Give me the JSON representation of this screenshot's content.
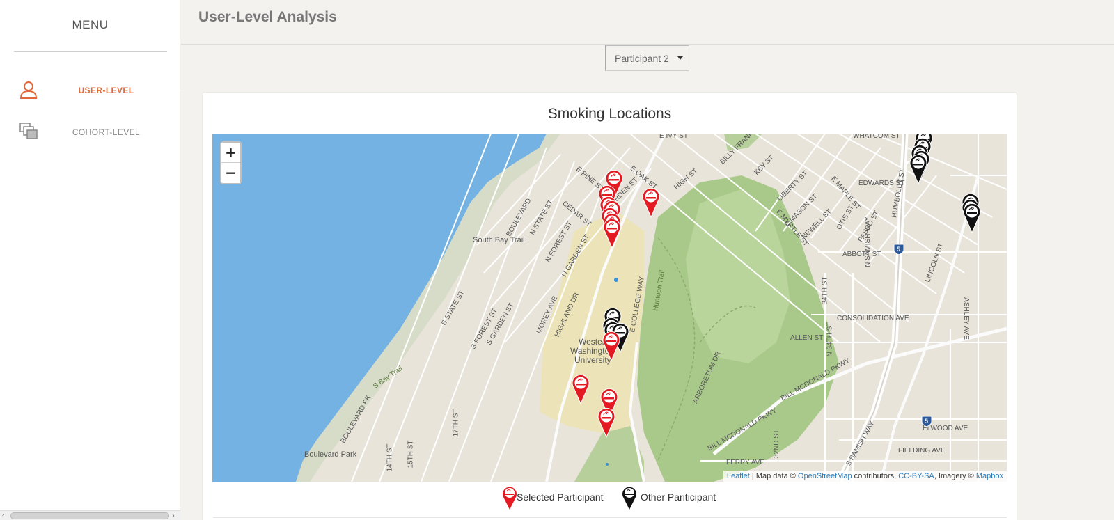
{
  "sidebar": {
    "menu_title": "MENU",
    "items": [
      {
        "label": "USER-LEVEL",
        "icon": "user-icon",
        "active": true
      },
      {
        "label": "COHORT-LEVEL",
        "icon": "layers-icon",
        "active": false
      }
    ]
  },
  "header": {
    "title": "User-Level Analysis"
  },
  "participant_select": {
    "selected": "Participant 2"
  },
  "card": {
    "title": "Smoking Locations"
  },
  "map": {
    "zoom_in": "+",
    "zoom_out": "−",
    "attribution": {
      "leaflet": "Leaflet",
      "sep1": " | Map data © ",
      "osm": "OpenStreetMap",
      "sep2": " contributors, ",
      "license": "CC-BY-SA",
      "sep3": ", Imagery © ",
      "mapbox": "Mapbox"
    },
    "labels": {
      "south_bay_trail": "South Bay Trail",
      "boulevard_park": "Boulevard Park",
      "western": "Western",
      "washington": "Washington",
      "university": "University",
      "consolidation": "CONSOLIDATION AVE",
      "abbott": "ABBOTT ST",
      "edwards": "EDWARDS ST",
      "allen": "ALLEN ST",
      "ferry": "FERRY AVE",
      "fielding": "FIELDING AVE",
      "elwood": "ELWOOD AVE",
      "whatcom": "WHATCOM ST",
      "high": "HIGH ST",
      "ivy": "E IVY ST",
      "pine": "E PINE ST",
      "cedar": "CEDAR ST",
      "boulevard": "BOULEVARD",
      "n_state": "N STATE ST",
      "n_forest": "N FOREST ST",
      "n_garden": "N GARDEN ST",
      "highland": "HIGHLAND DR",
      "morey": "MOREY AVE",
      "s_state": "S STATE ST",
      "s_forest": "S FOREST ST",
      "s_garden": "S GARDEN ST",
      "e_college": "E COLLEGE WAY",
      "huntoon": "Huntoon Trail",
      "arboretum": "ARBORETUM DR",
      "bill_mcdonald": "BILL MCDONALD PKWY",
      "samish": "S SAMISH WAY",
      "n_samish": "N SAMISH WAY",
      "lincoln": "LINCOLN ST",
      "ashley": "ASHLEY AVE",
      "humboldt": "HUMBOLDT ST",
      "key": "KEY ST",
      "liberty": "LIBERTY ST",
      "mason": "E MASON ST",
      "myrtle": "E MYRTLE ST",
      "newell": "NEWELL ST",
      "otis": "OTIS ST",
      "pasco": "PASCO ST",
      "maple": "E MAPLE ST",
      "billy_frank": "BILLY FRANK",
      "oak": "E OAK ST",
      "garden_top": "GARDEN ST",
      "34th": "34TH ST",
      "n34th": "N 34TH ST",
      "32nd": "32ND ST",
      "14th": "14TH ST",
      "15th": "15TH ST",
      "17th": "17TH ST",
      "boulevard_pk": "BOULEVARD PK",
      "s_bay_trail": "S Bay Trail",
      "hwy5": "5"
    },
    "markers": {
      "selected_color": "#e41a22",
      "other_color": "#111111"
    }
  },
  "legend": {
    "selected": "Selected Participant",
    "other": "Other Pariticipant"
  }
}
